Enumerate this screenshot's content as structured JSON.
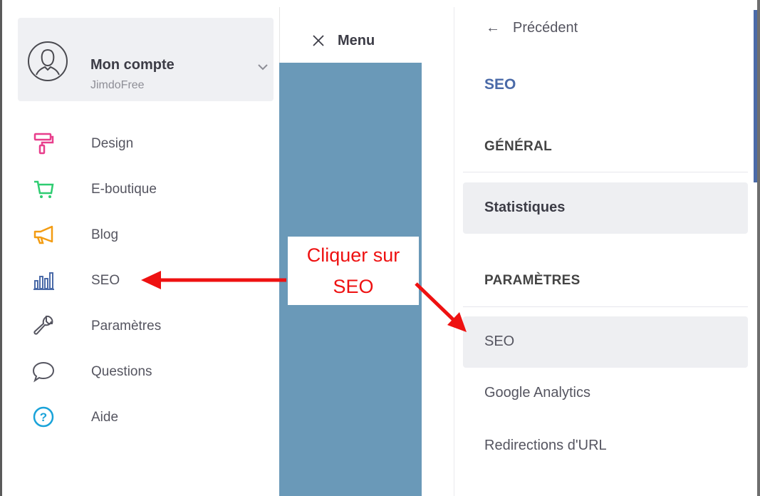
{
  "account": {
    "name": "Mon compte",
    "plan": "JimdoFree"
  },
  "nav": {
    "items": [
      {
        "label": "Design",
        "icon": "paint-roller-icon",
        "color": "#e83e8c"
      },
      {
        "label": "E-boutique",
        "icon": "cart-icon",
        "color": "#2ecc71"
      },
      {
        "label": "Blog",
        "icon": "megaphone-icon",
        "color": "#f39c12"
      },
      {
        "label": "SEO",
        "icon": "bar-chart-icon",
        "color": "#4a6aa8"
      },
      {
        "label": "Paramètres",
        "icon": "wrench-icon",
        "color": "#555560"
      },
      {
        "label": "Questions",
        "icon": "speech-bubble-icon",
        "color": "#555560"
      },
      {
        "label": "Aide",
        "icon": "help-circle-icon",
        "color": "#1aa3d9"
      }
    ]
  },
  "middle": {
    "menu_label": "Menu",
    "close_icon": "close-icon"
  },
  "annotation": {
    "line1": "Cliquer sur",
    "line2": "SEO",
    "color": "#ee1111"
  },
  "right": {
    "back_label": "Précédent",
    "title": "SEO",
    "section_general": "GÉNÉRAL",
    "item_stats": "Statistiques",
    "section_params": "PARAMÈTRES",
    "item_seo": "SEO",
    "item_ga": "Google Analytics",
    "item_redirect": "Redirections d'URL"
  }
}
